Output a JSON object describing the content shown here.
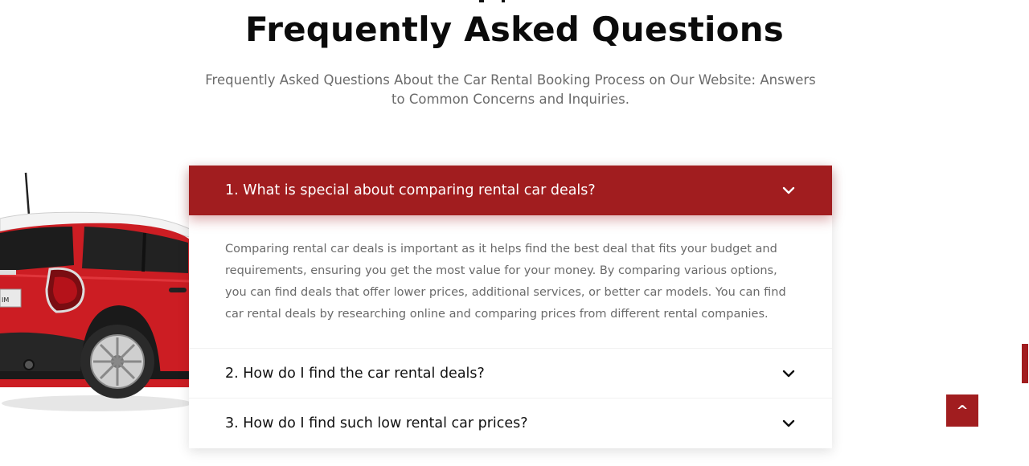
{
  "section": {
    "title": "Frequently Asked Questions",
    "subtitle": "Frequently Asked Questions About the Car Rental Booking Process on Our Website: Answers to Common Concerns and Inquiries."
  },
  "faq": {
    "items": [
      {
        "question": "1. What is special about comparing rental car deals?",
        "answer": "Comparing rental car deals is important as it helps find the best deal that fits your budget and requirements, ensuring you get the most value for your money. By comparing various options, you can find deals that offer lower prices, additional services, or better car models. You can find car rental deals by researching online and comparing prices from different rental companies.",
        "expanded": true
      },
      {
        "question": "2. How do I find the car rental deals?",
        "expanded": false
      },
      {
        "question": "3. How do I find such low rental car prices?",
        "expanded": false
      }
    ]
  },
  "back_to_top": {
    "label": "^"
  },
  "icons": {
    "faq_toggle": "chevron-down-icon",
    "back_to_top": "caret-up-icon",
    "car": "red-car-illustration"
  },
  "colors": {
    "accent": "#a11d1f",
    "title": "#0b0b0b",
    "body_text": "#6a6a6a"
  }
}
